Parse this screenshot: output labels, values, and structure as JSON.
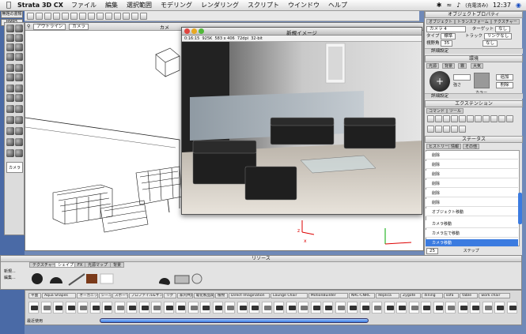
{
  "menubar": {
    "app_name": "Strata 3D CX",
    "items": [
      "ファイル",
      "編集",
      "選択範囲",
      "モデリング",
      "レンダリング",
      "スクリプト",
      "ウインドウ",
      "ヘルプ"
    ],
    "battery": "(充電済み)",
    "clock": "12:37"
  },
  "desktop": {
    "icon1": "無題の書類",
    "icon2": "HMR5"
  },
  "model_window": {
    "title": "カメ",
    "view_select": "アウトライン",
    "camera_select": "カメラ"
  },
  "render_window": {
    "title": "新規イメージ",
    "info": {
      "time": "0:16:15",
      "size": "925K",
      "dims": "583 x 406",
      "dpi": "72dpi",
      "depth": "32-bit"
    }
  },
  "object_panel": {
    "title": "オブジェクトプロパティ",
    "tabs": [
      "オブジェクト",
      "トランスフォーム",
      "テクスチャー"
    ],
    "name_field": "カメラ 4",
    "target_label": "ターゲット",
    "target_value": "なし",
    "type_label": "タイプ",
    "type_value": "標準",
    "track_label": "トラック",
    "track_value": "リンクなし",
    "fov_label": "視野角",
    "fov_value": "35",
    "fit_label": "なし",
    "detail_section": "詳細設定"
  },
  "env_panel": {
    "title": "環境",
    "tabs": [
      "光源",
      "背景",
      "霧",
      "大気"
    ],
    "strength_label": "強さ",
    "color_label": "カラー",
    "add_label": "追加",
    "delete_label": "削除",
    "detail_section": "詳細設定"
  },
  "extension_panel": {
    "title": "エクステンション",
    "tabs": [
      "コマンド",
      "ツール"
    ]
  },
  "status_panel": {
    "title": "ステータス",
    "tabs": [
      "ヒストリー",
      "情報",
      "その他"
    ],
    "history": [
      "削除",
      "削除",
      "削除",
      "削除",
      "削除",
      "削除",
      "オブジェクト移動",
      "カメラ移動",
      "カメラ左で移動",
      "カメラ移動"
    ],
    "footer_value": "25",
    "footer_label": "ステップ"
  },
  "resource_panel": {
    "title": "リソース",
    "tabs": [
      "テクスチャー",
      "シェイプ",
      "FX",
      "光源マップ",
      "背景"
    ],
    "left_labels": [
      "新規...",
      "編集..."
    ]
  },
  "library": {
    "tabs": [
      "平面",
      "Aqua Shapes",
      "オーガニック",
      "シーン",
      "スポーツ",
      "プロファイル&サンプル",
      "リグ",
      "家内共具",
      "電化製品関連",
      "植物",
      "Direct Imagination",
      "Lounge Chair",
      "MotionBuilder",
      "NRC-CNRC",
      "Replica",
      "Zygote",
      "dining",
      "sofa",
      "table",
      "work chair"
    ],
    "footer_label": "最近使用"
  },
  "colors": {
    "desktop": "#4a6aa6",
    "selection": "#3b7be0"
  }
}
